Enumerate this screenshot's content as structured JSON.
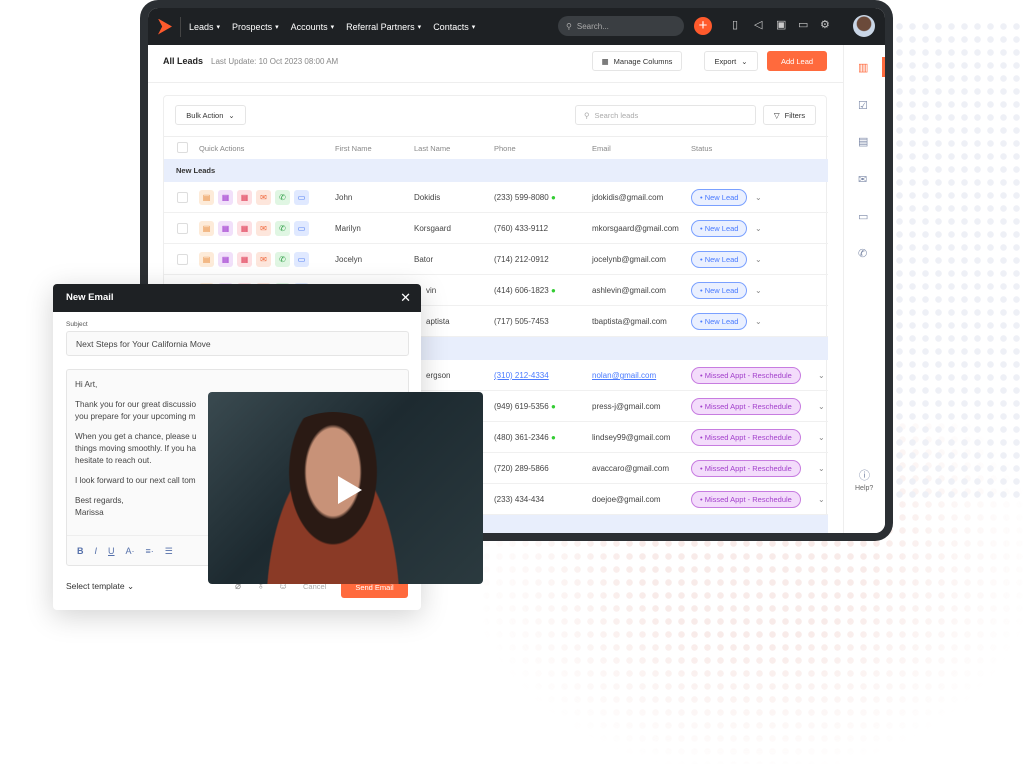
{
  "nav": {
    "items": [
      "Leads",
      "Prospects",
      "Accounts",
      "Referral Partners",
      "Contacts"
    ],
    "search_placeholder": "Search..."
  },
  "page": {
    "title": "All Leads",
    "last_update": "Last Update: 10 Oct 2023 08:00 AM",
    "manage_columns": "Manage Columns",
    "export": "Export",
    "add_lead": "Add Lead"
  },
  "toolbar": {
    "bulk_action": "Bulk Action",
    "search_placeholder": "Search leads",
    "filters": "Filters"
  },
  "columns": [
    "Quick Actions",
    "First Name",
    "Last Name",
    "Phone",
    "Email",
    "Status"
  ],
  "groups": [
    {
      "name": "New Leads",
      "rows": [
        {
          "first": "John",
          "last": "Dokidis",
          "phone": "(233) 599-8080",
          "online": true,
          "email": "jdokidis@gmail.com",
          "status": "• New Lead"
        },
        {
          "first": "Marilyn",
          "last": "Korsgaard",
          "phone": "(760) 433-9112",
          "online": false,
          "email": "mkorsgaard@gmail.com",
          "status": "• New Lead"
        },
        {
          "first": "Jocelyn",
          "last": "Bator",
          "phone": "(714) 212-0912",
          "online": false,
          "email": "jocelynb@gmail.com",
          "status": "• New Lead"
        },
        {
          "first": "",
          "last": "vin",
          "phone": "(414) 606-1823",
          "online": true,
          "email": "ashlevin@gmail.com",
          "status": "• New Lead"
        },
        {
          "first": "",
          "last": "aptista",
          "phone": "(717) 505-7453",
          "online": false,
          "email": "tbaptista@gmail.com",
          "status": "• New Lead"
        }
      ]
    },
    {
      "name": "",
      "rows": [
        {
          "last": "ergson",
          "phone": "(310) 212-4334",
          "email": "nolan@gmail.com",
          "status": "• Missed Appt - Reschedule"
        },
        {
          "last": "",
          "phone": "(949) 619-5356",
          "online": true,
          "email": "press-j@gmail.com",
          "status": "• Missed Appt - Reschedule"
        },
        {
          "last": "",
          "phone": "(480) 361-2346",
          "online": true,
          "email": "lindsey99@gmail.com",
          "status": "• Missed Appt - Reschedule"
        },
        {
          "last": "",
          "phone": "(720) 289-5866",
          "email": "avaccaro@gmail.com",
          "status": "• Missed Appt - Reschedule"
        },
        {
          "last": "",
          "phone": "(233) 434-434",
          "email": "doejoe@gmail.com",
          "status": "• Missed Appt - Reschedule"
        }
      ]
    }
  ],
  "help": "Help?",
  "email": {
    "title": "New Email",
    "subject_label": "Subject",
    "subject": "Next Steps for Your California Move",
    "body": [
      "Hi Art,",
      "Thank you for our great discussio",
      "you prepare for your upcoming m",
      "When you get a chance, please u",
      "things moving smoothly. If you ha",
      "hesitate to reach out.",
      "I look forward to our next call tom",
      "Best regards,",
      "Marissa"
    ],
    "select_template": "Select template",
    "cancel": "Cancel",
    "send": "Send Email"
  },
  "colors": {
    "accent": "#ff5a2c",
    "new_lead": "#4a7bff",
    "missed": "#a23fcb"
  }
}
